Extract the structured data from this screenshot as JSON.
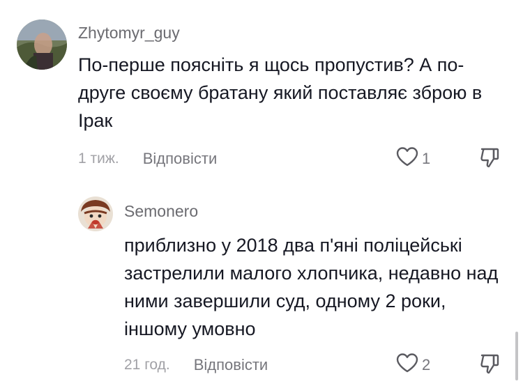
{
  "comments": [
    {
      "username": "Zhytomyr_guy",
      "text": "По-перше поясніть я щось пропустив? А по-друге своєму братану який поставляє зброю в Ірак",
      "timestamp": "1 тиж.",
      "reply_label": "Відповісти",
      "likes": "1",
      "avatar_icon": "avatar-photo",
      "like_icon": "heart-outline-icon",
      "dislike_icon": "thumbs-down-icon"
    },
    {
      "username": "Semonero",
      "text": "приблизно у 2018 два п'яні поліцейські застрелили малого хлопчика, недавно над ними завершили суд, одному 2 роки, іншому умовно",
      "timestamp": "21 год.",
      "reply_label": "Відповісти",
      "likes": "2",
      "avatar_icon": "avatar-cartoon",
      "like_icon": "heart-outline-icon",
      "dislike_icon": "thumbs-down-icon"
    }
  ],
  "colors": {
    "text_primary": "#161823",
    "text_secondary": "#6b6b70",
    "text_muted": "#a1a1a6",
    "icon": "#5a5a60"
  }
}
